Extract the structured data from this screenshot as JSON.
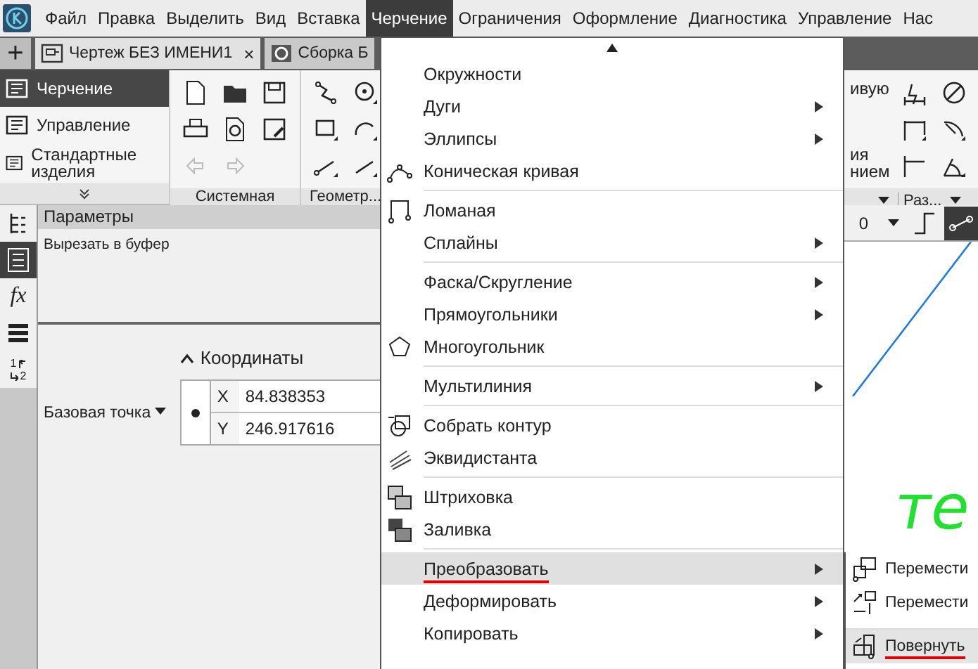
{
  "menubar": {
    "items": [
      {
        "label": "Файл",
        "selected": false
      },
      {
        "label": "Правка",
        "selected": false
      },
      {
        "label": "Выделить",
        "selected": false
      },
      {
        "label": "Вид",
        "selected": false
      },
      {
        "label": "Вставка",
        "selected": false
      },
      {
        "label": "Черчение",
        "selected": true
      },
      {
        "label": "Ограничения",
        "selected": false
      },
      {
        "label": "Оформление",
        "selected": false
      },
      {
        "label": "Диагностика",
        "selected": false
      },
      {
        "label": "Управление",
        "selected": false
      },
      {
        "label": "Нас",
        "selected": false
      }
    ]
  },
  "add_tab": "+",
  "tabs": [
    {
      "label": "Чертеж БЕЗ ИМЕНИ1",
      "selected": true,
      "close": "×"
    },
    {
      "label": "Сборка Б",
      "selected": false
    }
  ],
  "ribbon": {
    "modes": [
      {
        "label": "Черчение",
        "selected": true
      },
      {
        "label": "Управление",
        "selected": false
      },
      {
        "label": "Стандартные изделия",
        "selected": false
      }
    ],
    "groups": [
      {
        "label": "Системная"
      },
      {
        "label": "Геометр..."
      }
    ],
    "right_texts": [
      "ивую",
      "ия",
      "нием"
    ],
    "right_group": "Раз..."
  },
  "side_tools": [
    {
      "selected": false
    },
    {
      "selected": true
    },
    {
      "selected": false,
      "label": "fx"
    },
    {
      "selected": false
    },
    {
      "selected": false,
      "digits": [
        "1",
        "2"
      ]
    }
  ],
  "parameters": {
    "title": "Параметры",
    "hint": "Вырезать в буфер",
    "section": "Координаты",
    "expanded": true,
    "base_point": "Базовая точка",
    "x_label": "X",
    "x_value": "84.838353",
    "y_label": "Y",
    "y_value": "246.917616"
  },
  "canvas": {
    "toolbar_value": "0",
    "text": "те"
  },
  "menu": {
    "items": [
      {
        "kind": "item",
        "label": "Окружности",
        "submenu": false,
        "selected": false,
        "underlined": false
      },
      {
        "kind": "item",
        "label": "Дуги",
        "submenu": true,
        "selected": false,
        "underlined": false
      },
      {
        "kind": "item",
        "label": "Эллипсы",
        "submenu": true,
        "selected": false,
        "underlined": false
      },
      {
        "kind": "item",
        "label": "Коническая кривая",
        "submenu": false,
        "selected": false,
        "underlined": false
      },
      {
        "kind": "separator"
      },
      {
        "kind": "item",
        "label": "Ломаная",
        "submenu": false,
        "selected": false,
        "underlined": false
      },
      {
        "kind": "item",
        "label": "Сплайны",
        "submenu": true,
        "selected": false,
        "underlined": false
      },
      {
        "kind": "separator"
      },
      {
        "kind": "item",
        "label": "Фаска/Скругление",
        "submenu": true,
        "selected": false,
        "underlined": false
      },
      {
        "kind": "item",
        "label": "Прямоугольники",
        "submenu": true,
        "selected": false,
        "underlined": false
      },
      {
        "kind": "item",
        "label": "Многоугольник",
        "submenu": false,
        "selected": false,
        "underlined": false
      },
      {
        "kind": "separator"
      },
      {
        "kind": "item",
        "label": "Мультилиния",
        "submenu": true,
        "selected": false,
        "underlined": false
      },
      {
        "kind": "separator"
      },
      {
        "kind": "item",
        "label": "Собрать контур",
        "submenu": false,
        "selected": false,
        "underlined": false
      },
      {
        "kind": "item",
        "label": "Эквидистанта",
        "submenu": false,
        "selected": false,
        "underlined": false
      },
      {
        "kind": "separator"
      },
      {
        "kind": "item",
        "label": "Штриховка",
        "submenu": false,
        "selected": false,
        "underlined": false
      },
      {
        "kind": "item",
        "label": "Заливка",
        "submenu": false,
        "selected": false,
        "underlined": false
      },
      {
        "kind": "separator"
      },
      {
        "kind": "item",
        "label": "Преобразовать",
        "submenu": true,
        "selected": true,
        "underlined": true
      },
      {
        "kind": "item",
        "label": "Деформировать",
        "submenu": true,
        "selected": false,
        "underlined": false
      },
      {
        "kind": "item",
        "label": "Копировать",
        "submenu": true,
        "selected": false,
        "underlined": false
      }
    ]
  },
  "submenu": {
    "items": [
      {
        "label": "Перемести",
        "selected": false,
        "underlined": false
      },
      {
        "label": "Перемести",
        "selected": false,
        "underlined": false
      },
      {
        "label": "Повернуть",
        "selected": true,
        "underlined": true
      }
    ]
  }
}
